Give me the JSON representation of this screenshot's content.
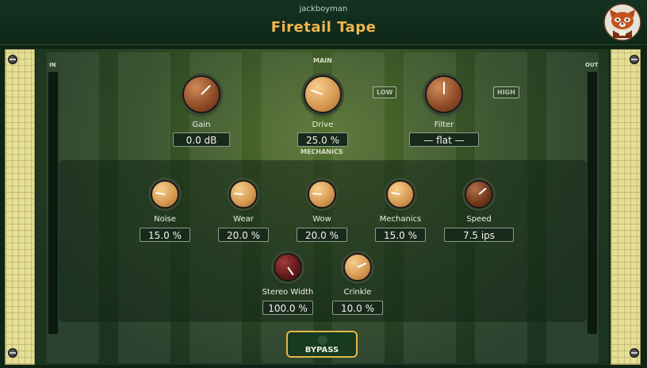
{
  "header": {
    "vendor": "jackboyman",
    "title": "Firetail Tape"
  },
  "meters": {
    "in_label": "IN",
    "out_label": "OUT"
  },
  "sections": {
    "main": "MAIN",
    "mechanics": "MECHANICS"
  },
  "main_knobs": [
    {
      "label": "Gain",
      "value": "0.0 dB",
      "style": "copper"
    },
    {
      "label": "Drive",
      "value": "25.0 %",
      "style": "gold"
    },
    {
      "label": "Filter",
      "value": "— flat —",
      "style": "copper"
    }
  ],
  "filter_buttons": {
    "low": "LOW",
    "high": "HIGH"
  },
  "mechanics_knobs": [
    {
      "label": "Noise",
      "value": "15.0 %",
      "style": "gold"
    },
    {
      "label": "Wear",
      "value": "20.0 %",
      "style": "gold"
    },
    {
      "label": "Wow",
      "value": "20.0 %",
      "style": "gold"
    },
    {
      "label": "Mechanics",
      "value": "15.0 %",
      "style": "gold"
    },
    {
      "label": "Speed",
      "value": "7.5 ips",
      "style": "dark-copper"
    },
    {
      "label": "Stereo Width",
      "value": "100.0 %",
      "style": "wine"
    },
    {
      "label": "Crinkle",
      "value": "10.0 %",
      "style": "gold"
    }
  ],
  "bypass": {
    "label": "BYPASS"
  },
  "colors": {
    "accent": "#f0b64c",
    "background": "#0f2415",
    "panel": "#2e4a24",
    "rail": "#e5de96"
  },
  "icons": {
    "logo": "red-panda-logo-icon",
    "screw": "screw-icon"
  }
}
